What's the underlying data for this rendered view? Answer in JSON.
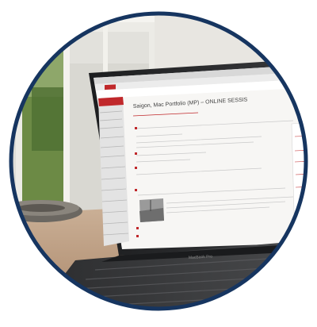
{
  "photo": {
    "subject": "laptop-with-online-course-page",
    "page_title": "Saigon, Mac Portfolio (MP) – ONLINE SESSIS",
    "keyboard_brand": "MacBook Pro"
  },
  "colors": {
    "frame_background": "#ffffff",
    "circle_border": "#163560",
    "window_frame": "#e9e7e2",
    "outdoor_green": "#5f7e3c",
    "desk_wood": "#b8977a",
    "laptop_body": "#26282b",
    "screen_white": "#f7f6f4",
    "accent_red": "#c0282b"
  }
}
